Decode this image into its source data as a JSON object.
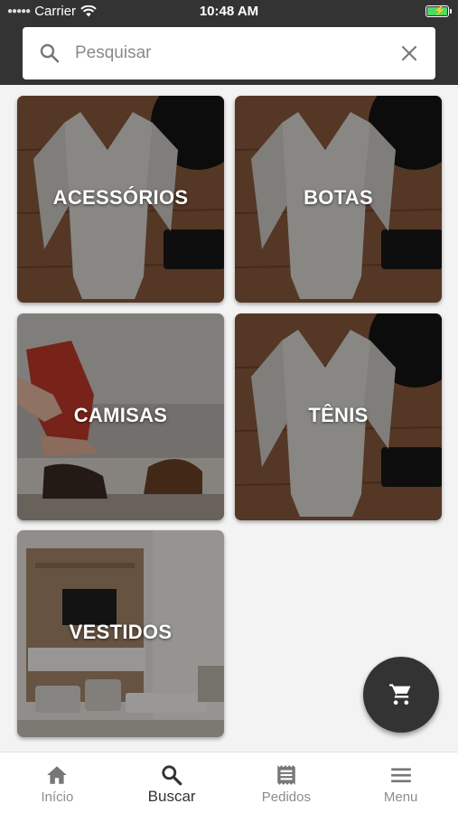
{
  "status_bar": {
    "carrier": "Carrier",
    "time": "10:48 AM"
  },
  "search": {
    "placeholder": "Pesquisar"
  },
  "categories": [
    {
      "label": "ACESSÓRIOS",
      "image": "dress-hat-bag"
    },
    {
      "label": "BOTAS",
      "image": "dress-hat-bag"
    },
    {
      "label": "CAMISAS",
      "image": "shoe-store"
    },
    {
      "label": "TÊNIS",
      "image": "dress-hat-bag"
    },
    {
      "label": "VESTIDOS",
      "image": "living-room"
    }
  ],
  "fab": {
    "icon": "shopping-cart-icon"
  },
  "bottom_nav": {
    "items": [
      {
        "label": "Início",
        "icon": "home-icon",
        "active": false
      },
      {
        "label": "Buscar",
        "icon": "search-icon",
        "active": true
      },
      {
        "label": "Pedidos",
        "icon": "receipt-icon",
        "active": false
      },
      {
        "label": "Menu",
        "icon": "menu-icon",
        "active": false
      }
    ]
  },
  "colors": {
    "header": "#333333",
    "background": "#f3f3f3",
    "active_nav": "#333333",
    "inactive_nav": "#8c8c8c"
  }
}
